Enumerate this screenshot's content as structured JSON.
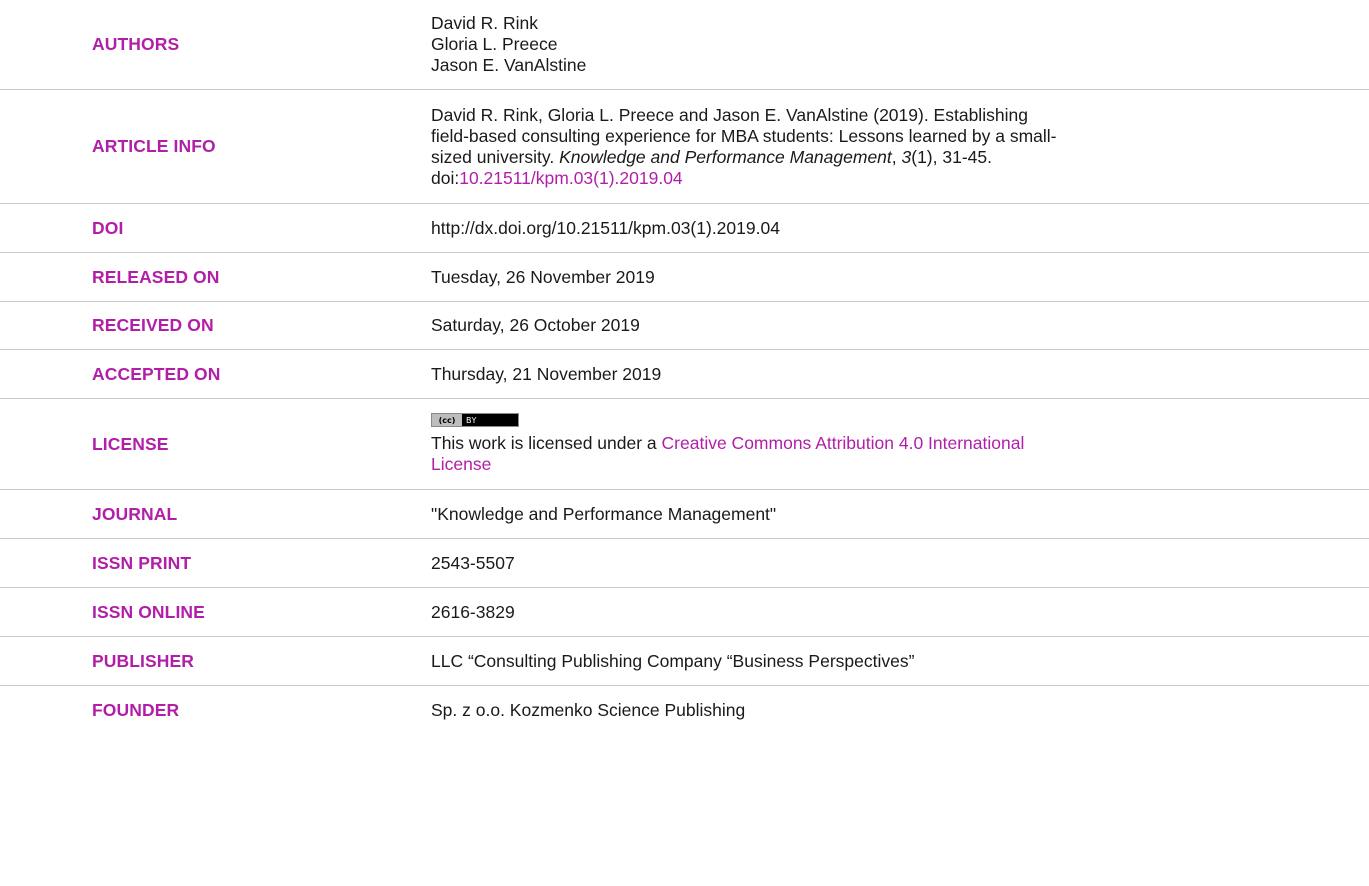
{
  "rows": {
    "authors": {
      "label": "AUTHORS",
      "names": [
        "David R. Rink",
        "Gloria L. Preece",
        "Jason E. VanAlstine"
      ]
    },
    "article_info": {
      "label": "ARTICLE INFO",
      "line1": "David R. Rink, Gloria L. Preece and Jason E. VanAlstine (2019). Establishing",
      "line2": "field-based consulting experience for MBA students: Lessons learned by a small-",
      "line3_pre": "sized university. ",
      "journal_italic": "Knowledge and Performance Management",
      "line3_mid": ", ",
      "volume_italic": "3",
      "line3_post": "(1), 31-45.",
      "doi_prefix": "doi:",
      "doi_link": "10.21511/kpm.03(1).2019.04"
    },
    "doi": {
      "label": "DOI",
      "value": "http://dx.doi.org/10.21511/kpm.03(1).2019.04"
    },
    "released": {
      "label": "RELEASED ON",
      "value": "Tuesday, 26 November 2019"
    },
    "received": {
      "label": "RECEIVED ON",
      "value": "Saturday, 26 October 2019"
    },
    "accepted": {
      "label": "ACCEPTED ON",
      "value": "Thursday, 21 November 2019"
    },
    "license": {
      "label": "LICENSE",
      "badge_left": "(cc)",
      "badge_right": "BY",
      "text_pre": "This work is licensed under a ",
      "link_line1": "Creative Commons Attribution 4.0 International",
      "link_line2": "License"
    },
    "journal": {
      "label": "JOURNAL",
      "value": "\"Knowledge and Performance Management\""
    },
    "issn_print": {
      "label": "ISSN PRINT",
      "value": "2543-5507"
    },
    "issn_online": {
      "label": "ISSN ONLINE",
      "value": "2616-3829"
    },
    "publisher": {
      "label": "PUBLISHER",
      "value": "LLC “Consulting Publishing Company “Business Perspectives”"
    },
    "founder": {
      "label": "FOUNDER",
      "value": "Sp. z o.o. Kozmenko Science Publishing"
    }
  },
  "colors": {
    "label": "#b11fa8",
    "link": "#b11fa8",
    "text": "#1a1a1a",
    "divider": "#c9c9c9"
  }
}
